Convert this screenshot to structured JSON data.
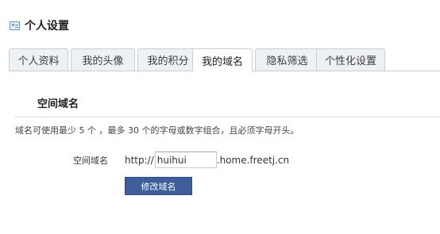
{
  "header": {
    "icon": "profile-card-icon",
    "title": "个人设置"
  },
  "tabs": [
    {
      "label": "个人资料"
    },
    {
      "label": "我的头像"
    },
    {
      "label": "我的积分"
    },
    {
      "label": "我的域名",
      "active": true
    },
    {
      "label": "隐私筛选"
    },
    {
      "label": "个性化设置"
    }
  ],
  "section": {
    "title": "空间域名",
    "hint": {
      "prefix": "域名可使用最少",
      "min": "5",
      "middle": "个 ，最多",
      "max": "30",
      "suffix": "个的字母或数字组合，且必须字母开头。"
    }
  },
  "form": {
    "label": "空间域名",
    "prefix": "http://",
    "value": "huihui",
    "suffix": ".home.freetj.cn",
    "submit_label": "修改域名"
  },
  "colors": {
    "accent": "#3f5d98",
    "tab_border": "#c5cdd6",
    "tab_bg": "#eef1f4"
  }
}
